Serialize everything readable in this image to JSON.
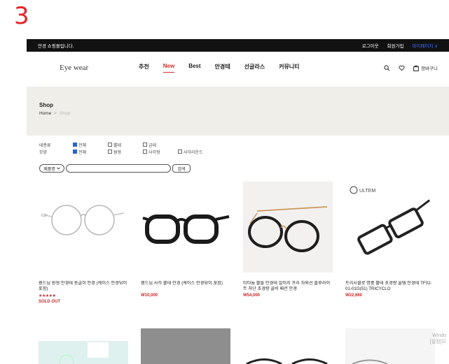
{
  "step_number": "3",
  "topbar": {
    "welcome": "안경 쇼핑몰입니다.",
    "logout": "로그아웃",
    "signup": "회원가입",
    "mypage": "마이페이지 ∨"
  },
  "nav": {
    "logo": "Eye wear",
    "menu": [
      "추천",
      "New",
      "Best",
      "안경테",
      "선글라스",
      "커뮤니티"
    ],
    "cart_label": "장바구니"
  },
  "shop": {
    "title": "Shop",
    "breadcrumb_home": "Home",
    "breadcrumb_sep": ">",
    "breadcrumb_current": "Shop"
  },
  "filters": {
    "material": {
      "label": "테종류",
      "options": [
        {
          "label": "전체",
          "checked": true
        },
        {
          "label": "뿔테",
          "checked": false
        },
        {
          "label": "금테",
          "checked": false
        }
      ]
    },
    "shape": {
      "label": "모양",
      "options": [
        {
          "label": "전체",
          "checked": true
        },
        {
          "label": "원형",
          "checked": false
        },
        {
          "label": "사각형",
          "checked": false
        },
        {
          "label": "사각라운드",
          "checked": false
        }
      ]
    }
  },
  "search": {
    "sort_value": "제품명",
    "input_value": "",
    "button_label": "검색"
  },
  "products": [
    {
      "name": "웬드님 원형 안경테 동글이 안경 (케이스 안경닦이 포함)",
      "stars": "★★★★★",
      "status": "SOLD OUT",
      "price": ""
    },
    {
      "name": "웬드님 사각 뿔테 안경 (케이스 안경닦이 포함)",
      "price": "W10,000"
    },
    {
      "name": "티타늄 뿔들 안경테 알러지 프리 자외선 블루라이트 차단 초경량 골비 패션 안경",
      "price": "W54,000"
    },
    {
      "name": "트리시클로 명품 뿔테 초경량 울템 안경테 TF02-01-01G(51) TRICYCLO",
      "price": "W22,660",
      "brand": "ULTEM"
    }
  ],
  "watermark": [
    "Windo",
    "[설정]으"
  ]
}
